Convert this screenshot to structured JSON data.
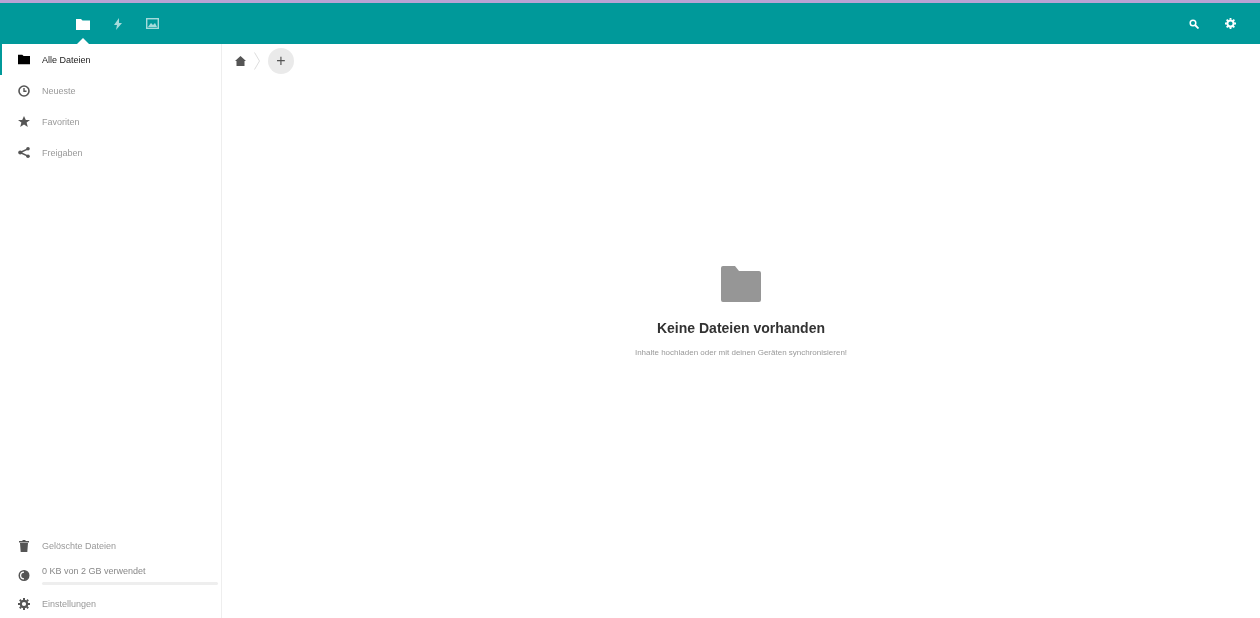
{
  "app_bar": {
    "apps": [
      {
        "selected": true
      },
      {
        "selected": false
      },
      {
        "selected": false
      }
    ]
  },
  "sidebar": {
    "items": [
      {
        "label": "Alle Dateien",
        "selected": true
      },
      {
        "label": "Neueste",
        "selected": false
      },
      {
        "label": "Favoriten",
        "selected": false
      },
      {
        "label": "Freigaben",
        "selected": false
      }
    ],
    "deleted": {
      "label": "Gelöschte Dateien"
    },
    "quota": {
      "label": "0 KB von 2 GB verwendet",
      "level": 0
    },
    "settings": {
      "label": "Einstellungen"
    }
  },
  "breadcrumb": {
    "add_button": "+"
  },
  "empty_state": {
    "title": "Keine Dateien vorhanden",
    "hint": "Inhalte hochladen oder mit deinen Geräten synchronisieren!"
  }
}
